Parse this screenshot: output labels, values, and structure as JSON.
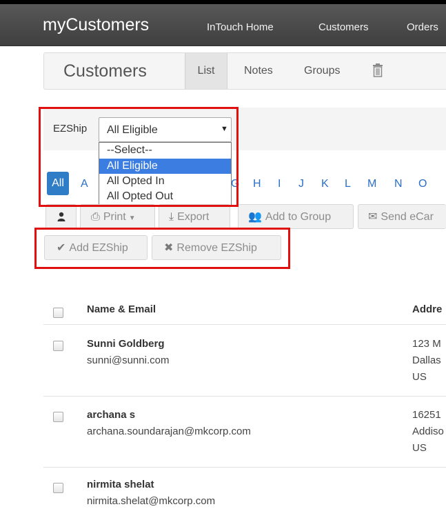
{
  "navbar": {
    "brand": "myCustomers",
    "links": [
      "InTouch Home",
      "Customers",
      "Orders"
    ]
  },
  "subnav": {
    "title": "Customers",
    "tabs": [
      "List",
      "Notes",
      "Groups"
    ],
    "active_tab": "List"
  },
  "filter": {
    "label": "EZShip",
    "selected": "All Eligible",
    "options": [
      "--Select--",
      "All Eligible",
      "All Opted In",
      "All Opted Out"
    ]
  },
  "alphabet": {
    "all_label": "All",
    "letters": [
      "A",
      "G",
      "H",
      "I",
      "J",
      "K",
      "L",
      "M",
      "N",
      "O"
    ]
  },
  "toolbar": {
    "print": "Print",
    "export": "Export",
    "add_group": "Add to Group",
    "send_ecard": "Send eCar",
    "add_ezship": "Add EZShip",
    "remove_ezship": "Remove EZShip"
  },
  "table": {
    "headers": {
      "name": "Name & Email",
      "address": "Addre"
    },
    "rows": [
      {
        "name": "Sunni Goldberg",
        "email": "sunni@sunni.com",
        "address": [
          "123 M",
          "Dallas",
          "US"
        ]
      },
      {
        "name": "archana s",
        "email": "archana.soundarajan@mkcorp.com",
        "address": [
          "16251",
          "Addiso",
          "US"
        ]
      },
      {
        "name": "nirmita shelat",
        "email": "nirmita.shelat@mkcorp.com",
        "address": []
      }
    ]
  },
  "colors": {
    "highlight_border": "#e01010",
    "selected_option": "#3b7de0",
    "active_letter": "#2f7cc7",
    "link": "#2a6fc9"
  }
}
